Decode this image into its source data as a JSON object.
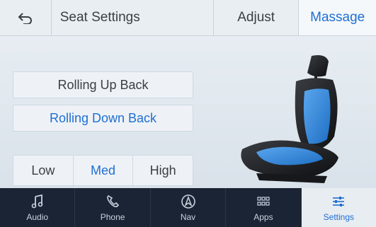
{
  "header": {
    "back_icon": "back-arrow-icon",
    "title": "Seat Settings",
    "tabs": [
      {
        "label": "Adjust"
      },
      {
        "label": "Massage",
        "active": true
      }
    ]
  },
  "massage": {
    "options": [
      {
        "label": "Rolling Up Back"
      },
      {
        "label": "Rolling Down Back",
        "selected": true
      }
    ],
    "intensity": [
      {
        "label": "Low"
      },
      {
        "label": "Med",
        "selected": true
      },
      {
        "label": "High"
      }
    ]
  },
  "nav": {
    "items": [
      {
        "label": "Audio",
        "icon": "music-note-icon"
      },
      {
        "label": "Phone",
        "icon": "phone-icon"
      },
      {
        "label": "Nav",
        "icon": "navigation-icon"
      },
      {
        "label": "Apps",
        "icon": "apps-grid-icon"
      },
      {
        "label": "Settings",
        "icon": "sliders-icon",
        "active": true
      }
    ]
  },
  "colors": {
    "accent": "#1f6fd1",
    "nav_bg": "#1a2434",
    "seat_highlight": "#3b8fe0"
  }
}
